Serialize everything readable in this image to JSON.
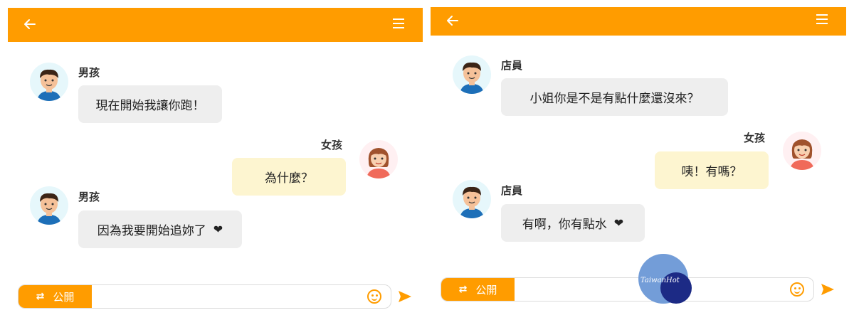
{
  "colors": {
    "accent": "#FF9C00",
    "bubble_incoming": "#EEEEEE",
    "bubble_outgoing": "#FDF5D0"
  },
  "left": {
    "header": {
      "back_icon": "back-arrow-icon",
      "menu_icon": "menu-icon"
    },
    "messages": [
      {
        "sender": "男孩",
        "text": "現在開始我讓你跑！",
        "side": "left"
      },
      {
        "sender": "女孩",
        "text": "為什麼？",
        "side": "right"
      },
      {
        "sender": "男孩",
        "text": "因為我要開始追妳了",
        "side": "left",
        "emoji": "❤"
      }
    ],
    "input": {
      "mode_label": "公開",
      "value": "",
      "placeholder": ""
    }
  },
  "right": {
    "header": {
      "back_icon": "back-arrow-icon",
      "menu_icon": "menu-icon"
    },
    "messages": [
      {
        "sender": "店員",
        "text": "小姐你是不是有點什麼還沒來？",
        "side": "left"
      },
      {
        "sender": "女孩",
        "text": "咦！有嗎？",
        "side": "right"
      },
      {
        "sender": "店員",
        "text": "有啊，你有點水",
        "side": "left",
        "emoji": "❤"
      }
    ],
    "input": {
      "mode_label": "公開",
      "value": "",
      "placeholder": ""
    }
  },
  "watermark": {
    "text": "TaiwanHot"
  }
}
